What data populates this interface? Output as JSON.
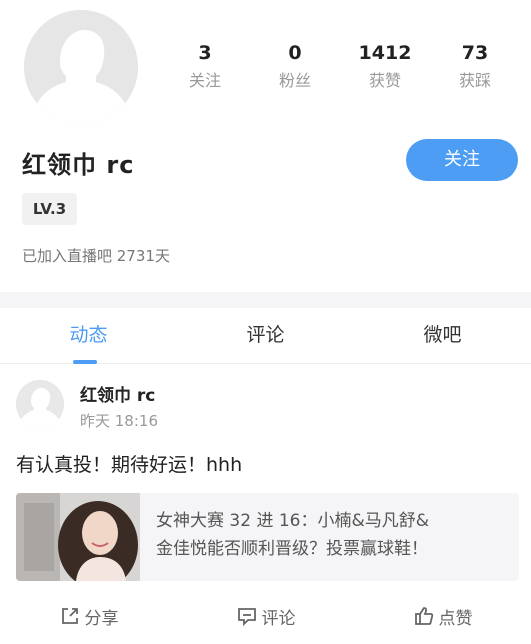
{
  "profile": {
    "username": "红领巾 rc",
    "level": "LV.3",
    "join_info": "已加入直播吧 2731天",
    "follow_button": "关注",
    "stats": [
      {
        "value": "3",
        "label": "关注"
      },
      {
        "value": "0",
        "label": "粉丝"
      },
      {
        "value": "1412",
        "label": "获赞"
      },
      {
        "value": "73",
        "label": "获踩"
      }
    ]
  },
  "tabs": [
    {
      "label": "动态",
      "active": true
    },
    {
      "label": "评论",
      "active": false
    },
    {
      "label": "微吧",
      "active": false
    }
  ],
  "post": {
    "username": "红领巾 rc",
    "time": "昨天 18:16",
    "text": "有认真投！期待好运！hhh",
    "card": {
      "line1": "女神大赛 32 进 16：小楠&马凡舒&",
      "line2": "金佳悦能否顺利晋级？投票赢球鞋！"
    },
    "actions": {
      "share": "分享",
      "comment": "评论",
      "like": "点赞"
    }
  },
  "colors": {
    "accent": "#4d9df5",
    "muted_text": "#999999",
    "divider": "#f5f5f7"
  },
  "icons": {
    "share": "share-icon",
    "comment": "comment-icon",
    "like": "thumbs-up-icon"
  }
}
